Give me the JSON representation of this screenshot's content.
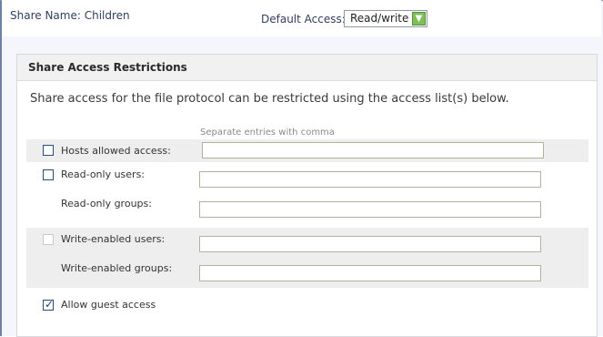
{
  "header": {
    "share_name": "Share Name: Children",
    "default_access_label": "Default Access:",
    "default_access_value": "Read/write"
  },
  "panel": {
    "title": "Share Access Restrictions",
    "description": "Share access for the file protocol can be restricted using the access list(s) below.",
    "hint": "Separate entries with comma",
    "fields": {
      "hosts_allowed": {
        "label": "Hosts allowed access:",
        "checked": false,
        "value": ""
      },
      "readonly_users": {
        "label": "Read-only users:",
        "checked": false,
        "value": ""
      },
      "readonly_groups": {
        "label": "Read-only groups:",
        "value": ""
      },
      "write_users": {
        "label": "Write-enabled users:",
        "checked": false,
        "disabled": true,
        "value": ""
      },
      "write_groups": {
        "label": "Write-enabled groups:",
        "value": ""
      },
      "guest_access": {
        "label": "Allow guest access",
        "checked": true
      }
    }
  },
  "colors": {
    "accent": "#7fbf5a",
    "checkbox_border": "#2c4a7a",
    "input_border": "#aab79a"
  },
  "icons": {
    "dropdown": "chevron-down-icon",
    "check": "checkmark-icon"
  }
}
